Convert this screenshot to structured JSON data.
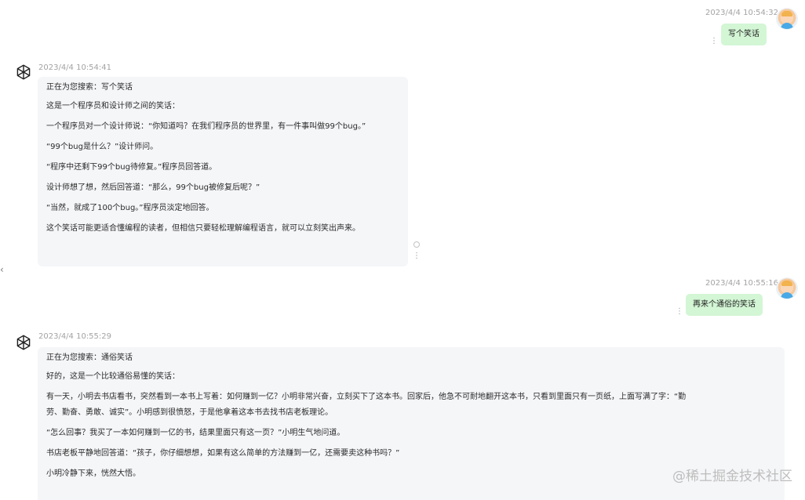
{
  "window": {
    "collapse_icon": "chevron-left-icon"
  },
  "messages": [
    {
      "role": "user",
      "timestamp": "2023/4/4 10:54:32",
      "text": "写个笑话"
    },
    {
      "role": "assistant",
      "timestamp": "2023/4/4 10:54:41",
      "lines": [
        "正在为您搜索：写个笑话",
        "这是一个程序员和设计师之间的笑话：",
        "一个程序员对一个设计师说：“你知道吗？在我们程序员的世界里，有一件事叫做99个bug。”",
        "“99个bug是什么？”设计师问。",
        "“程序中还剩下99个bug待修复。”程序员回答道。",
        "设计师想了想，然后回答道：“那么，99个bug被修复后呢？”",
        "“当然，就成了100个bug。”程序员淡定地回答。",
        "这个笑话可能更适合懂编程的读者，但相信只要轻松理解编程语言，就可以立刻笑出声来。"
      ]
    },
    {
      "role": "user",
      "timestamp": "2023/4/4 10:55:16",
      "text": "再来个通俗的笑话"
    },
    {
      "role": "assistant",
      "timestamp": "2023/4/4 10:55:29",
      "lines": [
        "正在为您搜索：通俗笑话",
        "好的，这是一个比较通俗易懂的笑话：",
        "有一天，小明去书店看书，突然看到一本书上写着：如何赚到一亿？小明非常兴奋，立刻买下了这本书。回家后，他急不可耐地翻开这本书，只看到里面只有一页纸，上面写满了字：“勤",
        "劳、勤奋、勇敢、诚实”。小明感到很愤怒，于是他拿着这本书去找书店老板理论。",
        "“怎么回事？我买了一本如何赚到一亿的书，结果里面只有这一页？”小明生气地问道。",
        "书店老板平静地回答道：“孩子，你仔细想想，如果有这么简单的方法赚到一亿，还需要卖这种书吗？”",
        "小明冷静下来，恍然大悟。"
      ]
    }
  ],
  "watermark": "@稀土掘金技术社区",
  "colors": {
    "user_bubble": "#d3f6d5",
    "assistant_bubble": "#f5f6f8",
    "timestamp": "#a3a3a3"
  }
}
